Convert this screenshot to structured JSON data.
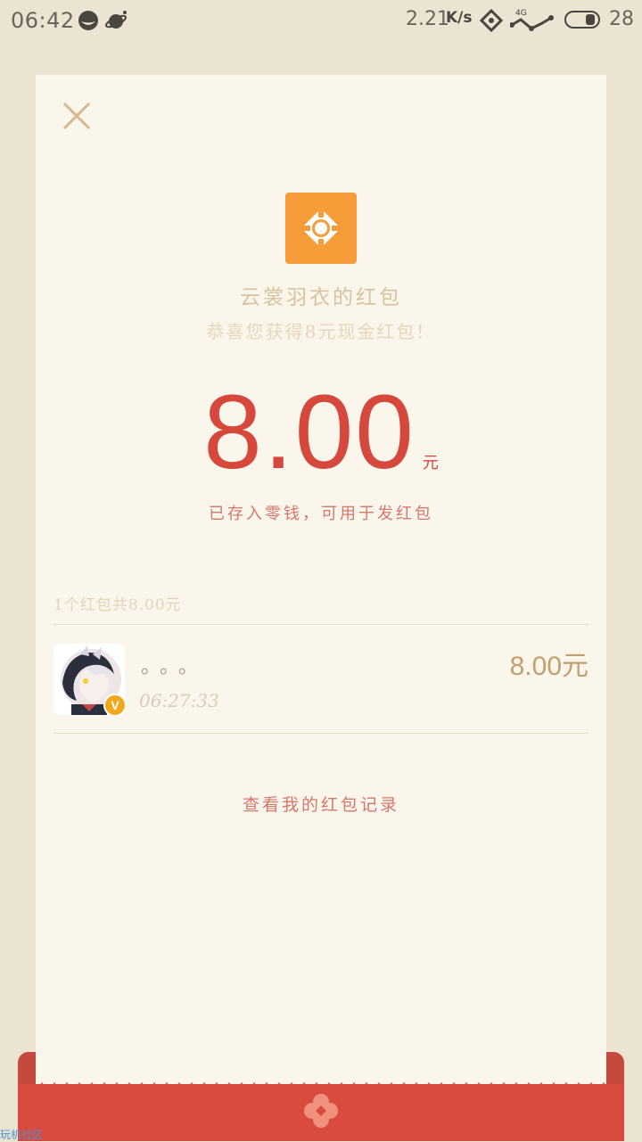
{
  "status_bar": {
    "time": "06:42",
    "speed": "2.21",
    "speed_unit": "K/s",
    "network": "4G",
    "battery": "28"
  },
  "card": {
    "sender_title": "云裳羽衣的红包",
    "greeting": "恭喜您获得8元现金红包！",
    "amount": "8.00",
    "amount_unit": "元",
    "stored_note": "已存入零钱，可用于发红包",
    "summary": "1个红包共8.00元",
    "history_link": "查看我的红包记录"
  },
  "record": {
    "name": "。。。",
    "time": "06:27:33",
    "amount": "8.00元",
    "verified_badge": "V"
  },
  "watermark": "玩机社区",
  "colors": {
    "background": "#ece4d2",
    "card": "#fbf6ec",
    "accent_red": "#d6473c",
    "logo_orange": "#f69d3a",
    "gold": "#c0a06f"
  },
  "icons": {
    "close": "close-icon",
    "logo": "red-packet-logo-icon",
    "verified": "verified-badge-icon",
    "ornament": "flower-ornament-icon"
  }
}
